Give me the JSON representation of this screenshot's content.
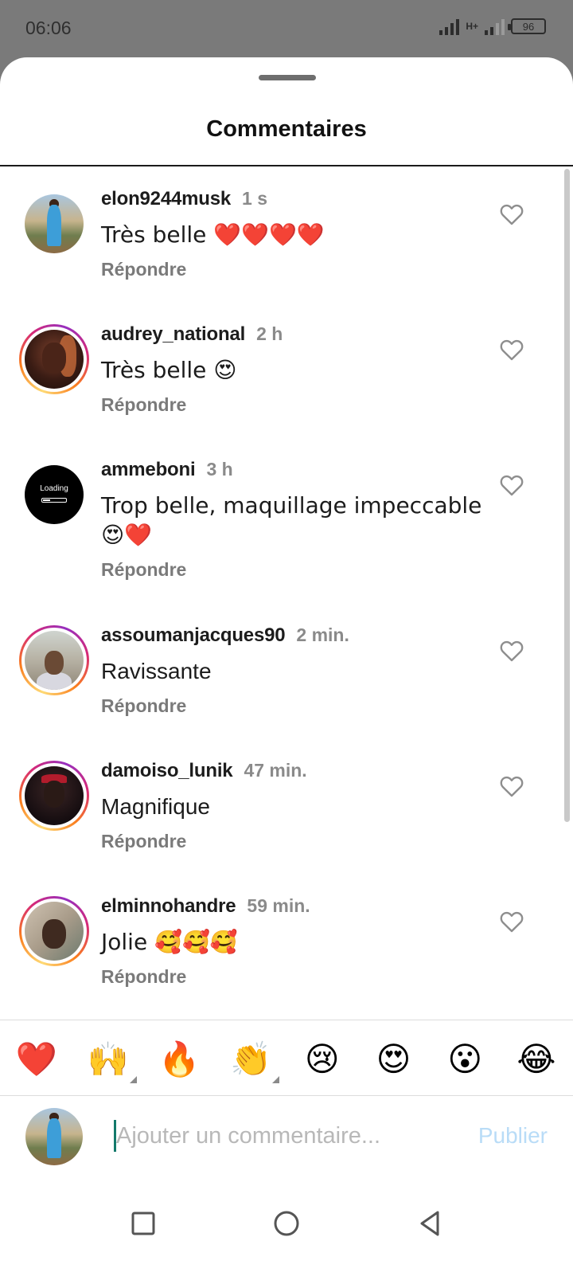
{
  "status_bar": {
    "time": "06:06",
    "network": "H+",
    "battery": "96"
  },
  "sheet": {
    "title": "Commentaires"
  },
  "comments": [
    {
      "user": "elon9244musk",
      "time": "1 s",
      "text": "Très belle ❤️❤️❤️❤️",
      "reply": "Répondre",
      "avatar": "outdoor-photo",
      "story_ring": false
    },
    {
      "user": "audrey_national",
      "time": "2 h",
      "text": "Très belle 😍",
      "reply": "Répondre",
      "avatar": "woman-photo",
      "story_ring": true
    },
    {
      "user": "ammeboni",
      "time": "3 h",
      "text": "Trop belle, maquillage impeccable 😍❤️",
      "reply": "Répondre",
      "avatar_text": "Loading",
      "story_ring": false
    },
    {
      "user": "assoumanjacques90",
      "time": "2 min.",
      "text": "Ravissante",
      "reply": "Répondre",
      "avatar": "man-photo",
      "story_ring": true
    },
    {
      "user": "damoiso_lunik",
      "time": "47 min.",
      "text": "Magnifique",
      "reply": "Répondre",
      "avatar": "man-red-cap-photo",
      "story_ring": true
    },
    {
      "user": "elminnohandre",
      "time": "59 min.",
      "text": "Jolie 🥰🥰🥰",
      "reply": "Répondre",
      "avatar": "man-selfie-photo",
      "story_ring": true
    }
  ],
  "emoji_bar": [
    "❤️",
    "🙌",
    "🔥",
    "👏",
    "😢",
    "😍",
    "😮",
    "😂"
  ],
  "input": {
    "placeholder": "Ajouter un commentaire...",
    "publish_label": "Publier"
  },
  "colors": {
    "publish_disabled": "#b9dcf7",
    "caret": "#137a6b",
    "story_ring": [
      "#feda75",
      "#fa7e1e",
      "#d62976",
      "#962fbf"
    ]
  }
}
